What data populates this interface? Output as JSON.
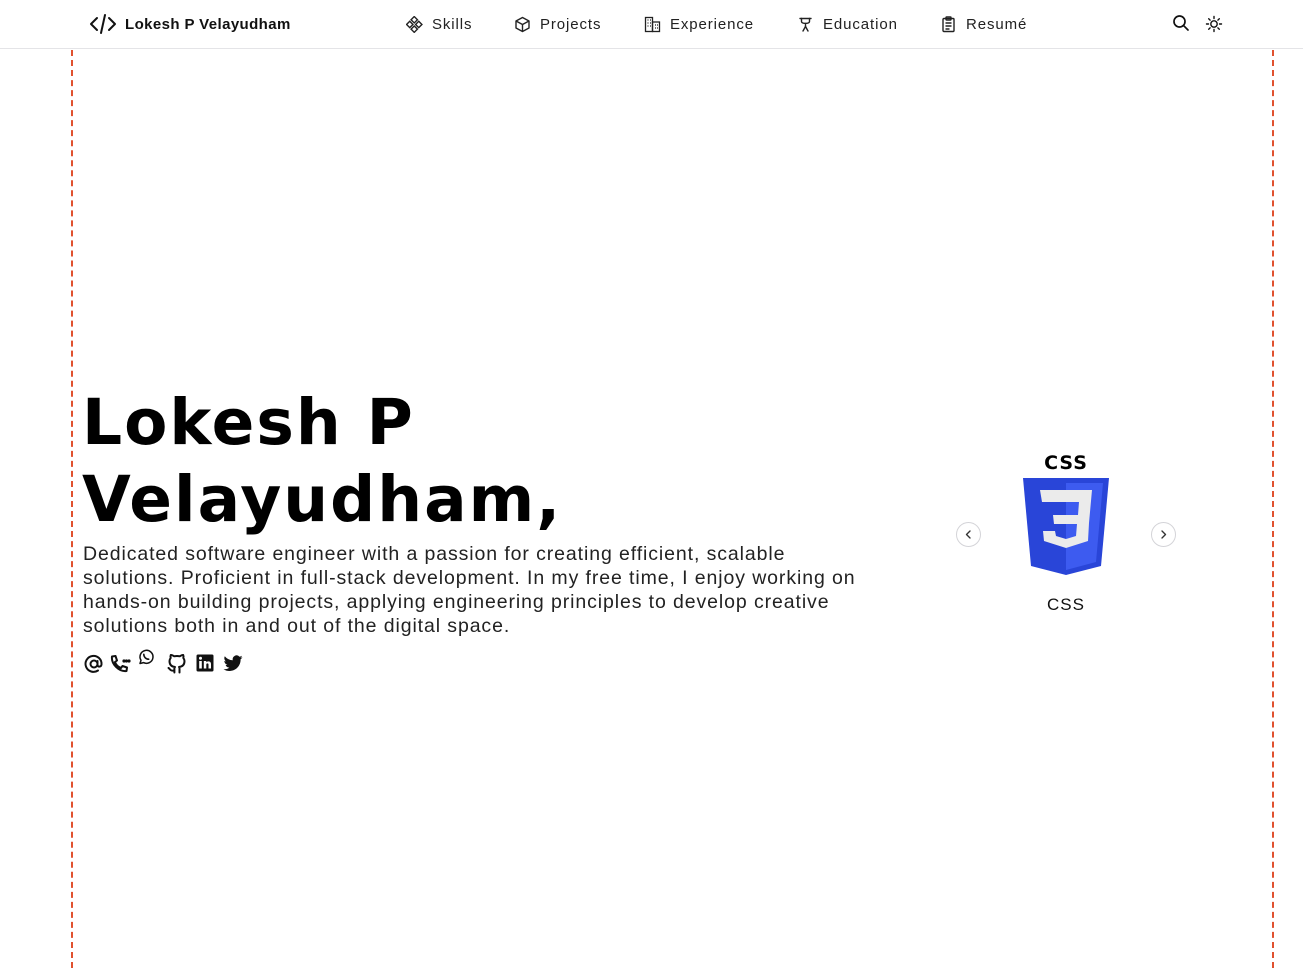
{
  "header": {
    "brand_icon": "code-brackets-icon",
    "brand_name": "Lokesh P Velayudham",
    "nav": [
      {
        "label": "Skills",
        "icon": "nodes-icon"
      },
      {
        "label": "Projects",
        "icon": "cube-icon"
      },
      {
        "label": "Experience",
        "icon": "building-icon"
      },
      {
        "label": "Education",
        "icon": "academic-icon"
      },
      {
        "label": "Resumé",
        "icon": "clipboard-icon"
      }
    ],
    "tools": [
      {
        "name": "search",
        "icon": "search-icon"
      },
      {
        "name": "theme",
        "icon": "sun-icon"
      }
    ]
  },
  "hero": {
    "name_line1": "Lokesh P",
    "name_line2": "Velayudham,",
    "bio": "Dedicated software engineer with a passion for creating efficient, scalable solutions. Proficient in full-stack development. In my free time, I enjoy working on hands-on building projects, applying engineering principles to develop creative solutions both in and out of the digital space.",
    "socials": [
      {
        "name": "email",
        "icon": "at-sign-icon"
      },
      {
        "name": "phone",
        "icon": "phone-icon"
      },
      {
        "name": "whatsapp",
        "icon": "whatsapp-icon"
      },
      {
        "name": "github",
        "icon": "github-icon"
      },
      {
        "name": "linkedin",
        "icon": "linkedin-icon"
      },
      {
        "name": "twitter",
        "icon": "twitter-icon"
      }
    ]
  },
  "carousel": {
    "current_skill": "CSS",
    "logo_text": "CSS",
    "logo_colors": {
      "shield": "#2945d8",
      "shield_light": "#3d5bf0",
      "three": "#ebebeb"
    },
    "prev_icon": "chevron-left-icon",
    "next_icon": "chevron-right-icon"
  },
  "colors": {
    "guide_line": "#e0512f",
    "text": "#111111",
    "header_border": "#e4e4e7"
  }
}
